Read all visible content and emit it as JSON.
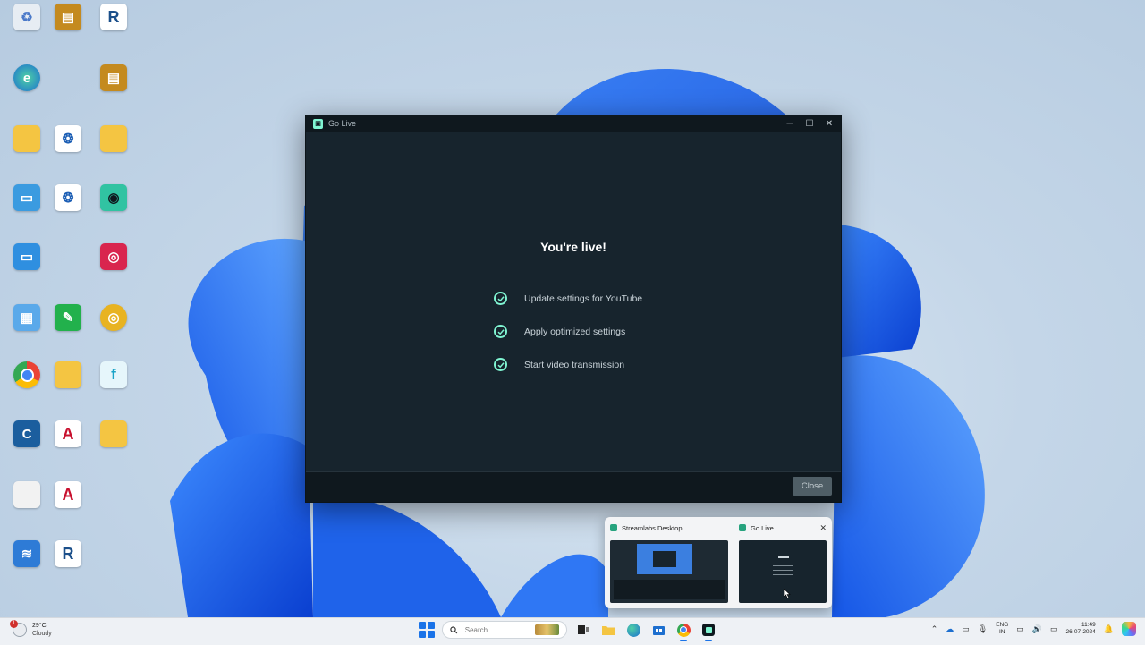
{
  "window": {
    "title": "Go Live",
    "controls": {
      "minimize": "─",
      "maximize": "☐",
      "close": "✕"
    },
    "heading": "You're live!",
    "steps": [
      {
        "label": "Update settings for YouTube",
        "status": "done"
      },
      {
        "label": "Apply optimized settings",
        "status": "done"
      },
      {
        "label": "Start video transmission",
        "status": "done"
      }
    ],
    "close_label": "Close"
  },
  "preview": {
    "items": [
      {
        "title": "Streamlabs Desktop"
      },
      {
        "title": "Go Live",
        "close": "✕"
      }
    ]
  },
  "taskbar": {
    "weather_temp": "29°C",
    "weather_cond": "Cloudy",
    "weather_badge": "1",
    "search_placeholder": "Search",
    "lang_line1": "ENG",
    "lang_line2": "IN",
    "time": "11:49",
    "date": "26-07-2024"
  },
  "colors": {
    "accent": "#80f5d2",
    "window_bg": "#17242d",
    "titlebar_bg": "#0f181e",
    "close_button": "#4f5e66"
  }
}
